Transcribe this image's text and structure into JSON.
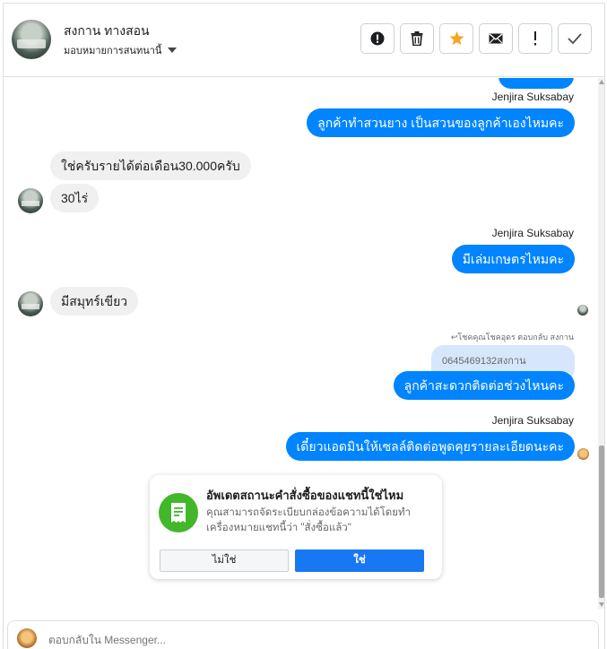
{
  "header": {
    "contact_name": "สงกาน ทางสอน",
    "assign_label": "มอบหมายการสนทนานี้",
    "actions": [
      {
        "icon": "alert-circle-icon"
      },
      {
        "icon": "trash-icon"
      },
      {
        "icon": "star-icon",
        "color": "#f5a623"
      },
      {
        "icon": "envelope-icon"
      },
      {
        "icon": "exclamation-icon"
      },
      {
        "icon": "checkmark-icon"
      }
    ]
  },
  "messages": {
    "sender_1": "Jenjira Suksabay",
    "out_1": "ลูกค้าทำสวนยาง เป็นสวนของลูกค้าเองไหมคะ",
    "in_1": "ใช่ครับรายได้ต่อเดือน30.000ครับ",
    "in_2": "30ไร่",
    "sender_2": "Jenjira Suksabay",
    "out_2": "มีเล่มเกษตรไหมคะ",
    "in_3": "มีสมุทร์เขียว",
    "reply_meta": "↩โชคคุณโชคอุดร ตอบกลับ สงกาน",
    "quoted": "0645469132สงกาน",
    "out_3": "ลูกค้าสะดวกติดต่อช่วงไหนคะ",
    "sender_3": "Jenjira Suksabay",
    "out_4": "เดี๋ยวแอดมินให้เซลล์ติดต่อพูดคุยรายละเอียดนะคะ"
  },
  "card": {
    "title": "อัพเดตสถานะคำสั่งซื้อของแชทนี้ใช่ไหม",
    "description": "คุณสามารถจัดระเบียบกล่องข้อความได้โดยทำเครื่องหมายแชทนี้ว่า \"สั่งซื้อแล้ว\"",
    "no_label": "ไม่ใช่",
    "yes_label": "ใช่",
    "icon": "receipt-icon"
  },
  "composer": {
    "placeholder": "ตอบกลับใน Messenger..."
  },
  "colors": {
    "outgoing": "#0084ff",
    "incoming": "#f0f0f0",
    "primary_button": "#1877f2",
    "order_icon_bg": "#42b72a"
  }
}
